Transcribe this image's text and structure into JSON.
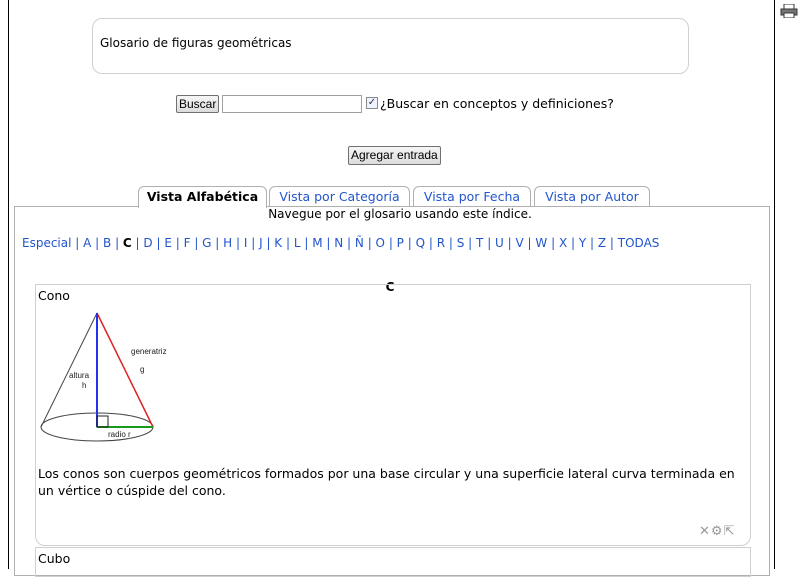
{
  "intro": {
    "text": "Glosario de figuras geométricas"
  },
  "search": {
    "button_label": "Buscar",
    "value": "",
    "checkbox_label": "¿Buscar en conceptos y definiciones?",
    "checked": true
  },
  "add_entry": {
    "label": "Agregar entrada"
  },
  "tabs": [
    {
      "label": "Vista Alfabética",
      "active": true
    },
    {
      "label": "Vista por Categoría"
    },
    {
      "label": "Vista por Fecha"
    },
    {
      "label": "Vista por Autor"
    }
  ],
  "nav_hint": "Navegue por el glosario usando este índice.",
  "alphabet": [
    "Especial",
    "A",
    "B",
    "C",
    "D",
    "E",
    "F",
    "G",
    "H",
    "I",
    "J",
    "K",
    "L",
    "M",
    "N",
    "Ñ",
    "O",
    "P",
    "Q",
    "R",
    "S",
    "T",
    "U",
    "V",
    "W",
    "X",
    "Y",
    "Z",
    "TODAS"
  ],
  "current_letter": "C",
  "entries": [
    {
      "title": "Cono",
      "figure_labels": {
        "altura": "altura",
        "h": "h",
        "generatriz": "generatriz",
        "g": "g",
        "radio": "radio  r"
      },
      "definition": "Los conos son cuerpos geométricos formados por una base circular y una superficie lateral curva terminada en un vértice o cúspide del cono.",
      "action_icons": [
        "delete-icon",
        "edit-icon",
        "export-icon"
      ]
    },
    {
      "title": "Cubo"
    }
  ],
  "colors": {
    "link": "#2255cc",
    "border": "#b0b0b0"
  }
}
